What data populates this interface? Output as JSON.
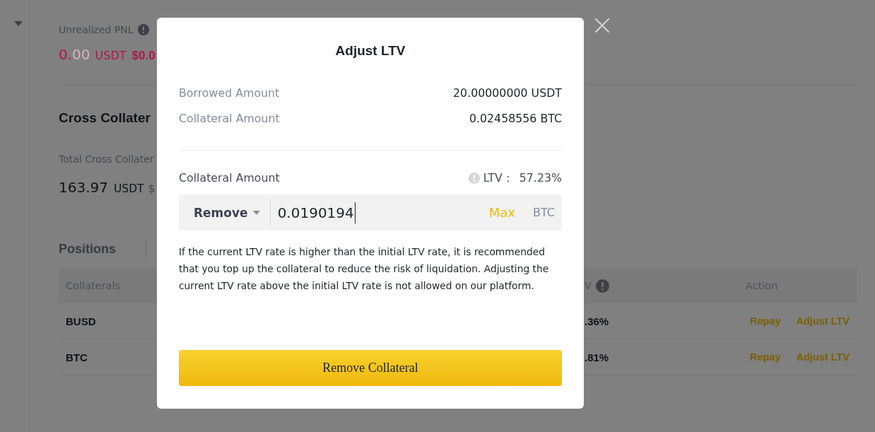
{
  "unrealized_pnl": {
    "label": "Unrealized PNL",
    "value": "0.",
    "value_faded": "00",
    "unit": "USDT",
    "fiat": "$0.0"
  },
  "cross_collateral": {
    "title": "Cross Collater",
    "total_label": "Total Cross Collater",
    "total_value": "163.97",
    "total_unit": "USDT",
    "total_fiat": "$"
  },
  "tabs": [
    {
      "label": "Positions",
      "selected": true
    }
  ],
  "table": {
    "columns": [
      {
        "label": "Collaterals",
        "info": false
      },
      {
        "label": "V",
        "info": true
      },
      {
        "label": "Action",
        "info": false
      }
    ],
    "rows": [
      {
        "cells": [
          "BUSD",
          ".36%"
        ],
        "actions": [
          "Repay",
          "Adjust LTV"
        ]
      },
      {
        "cells": [
          "BTC",
          ".81%"
        ],
        "actions": [
          "Repay",
          "Adjust LTV"
        ]
      }
    ]
  },
  "modal": {
    "title": "Adjust LTV",
    "details": [
      {
        "label": "Borrowed Amount",
        "value": "20.00000000 USDT"
      },
      {
        "label": "Collateral Amount",
        "value": "0.02458556 BTC"
      }
    ],
    "amount": {
      "label": "Collateral Amount",
      "ltv_label": "LTV：",
      "ltv_value": "57.23%",
      "mode": "Remove",
      "value": "0.0190194",
      "focused": true,
      "max": "Max",
      "unit": "BTC"
    },
    "note": "If the current LTV rate is higher than the initial LTV rate, it is recommended that you top up the collateral to reduce the risk of liquidation. Adjusting the current LTV rate above the initial LTV rate is not allowed on our platform.",
    "submit": "Remove Collateral"
  }
}
